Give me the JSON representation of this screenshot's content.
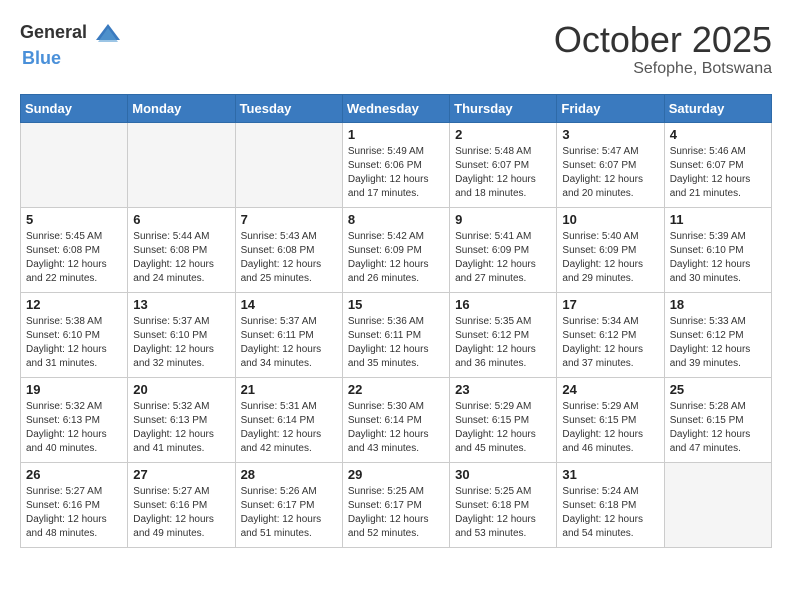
{
  "logo": {
    "general": "General",
    "blue": "Blue"
  },
  "title": {
    "month": "October 2025",
    "location": "Sefophe, Botswana"
  },
  "days_of_week": [
    "Sunday",
    "Monday",
    "Tuesday",
    "Wednesday",
    "Thursday",
    "Friday",
    "Saturday"
  ],
  "weeks": [
    [
      {
        "day": "",
        "info": ""
      },
      {
        "day": "",
        "info": ""
      },
      {
        "day": "",
        "info": ""
      },
      {
        "day": "1",
        "info": "Sunrise: 5:49 AM\nSunset: 6:06 PM\nDaylight: 12 hours\nand 17 minutes."
      },
      {
        "day": "2",
        "info": "Sunrise: 5:48 AM\nSunset: 6:07 PM\nDaylight: 12 hours\nand 18 minutes."
      },
      {
        "day": "3",
        "info": "Sunrise: 5:47 AM\nSunset: 6:07 PM\nDaylight: 12 hours\nand 20 minutes."
      },
      {
        "day": "4",
        "info": "Sunrise: 5:46 AM\nSunset: 6:07 PM\nDaylight: 12 hours\nand 21 minutes."
      }
    ],
    [
      {
        "day": "5",
        "info": "Sunrise: 5:45 AM\nSunset: 6:08 PM\nDaylight: 12 hours\nand 22 minutes."
      },
      {
        "day": "6",
        "info": "Sunrise: 5:44 AM\nSunset: 6:08 PM\nDaylight: 12 hours\nand 24 minutes."
      },
      {
        "day": "7",
        "info": "Sunrise: 5:43 AM\nSunset: 6:08 PM\nDaylight: 12 hours\nand 25 minutes."
      },
      {
        "day": "8",
        "info": "Sunrise: 5:42 AM\nSunset: 6:09 PM\nDaylight: 12 hours\nand 26 minutes."
      },
      {
        "day": "9",
        "info": "Sunrise: 5:41 AM\nSunset: 6:09 PM\nDaylight: 12 hours\nand 27 minutes."
      },
      {
        "day": "10",
        "info": "Sunrise: 5:40 AM\nSunset: 6:09 PM\nDaylight: 12 hours\nand 29 minutes."
      },
      {
        "day": "11",
        "info": "Sunrise: 5:39 AM\nSunset: 6:10 PM\nDaylight: 12 hours\nand 30 minutes."
      }
    ],
    [
      {
        "day": "12",
        "info": "Sunrise: 5:38 AM\nSunset: 6:10 PM\nDaylight: 12 hours\nand 31 minutes."
      },
      {
        "day": "13",
        "info": "Sunrise: 5:37 AM\nSunset: 6:10 PM\nDaylight: 12 hours\nand 32 minutes."
      },
      {
        "day": "14",
        "info": "Sunrise: 5:37 AM\nSunset: 6:11 PM\nDaylight: 12 hours\nand 34 minutes."
      },
      {
        "day": "15",
        "info": "Sunrise: 5:36 AM\nSunset: 6:11 PM\nDaylight: 12 hours\nand 35 minutes."
      },
      {
        "day": "16",
        "info": "Sunrise: 5:35 AM\nSunset: 6:12 PM\nDaylight: 12 hours\nand 36 minutes."
      },
      {
        "day": "17",
        "info": "Sunrise: 5:34 AM\nSunset: 6:12 PM\nDaylight: 12 hours\nand 37 minutes."
      },
      {
        "day": "18",
        "info": "Sunrise: 5:33 AM\nSunset: 6:12 PM\nDaylight: 12 hours\nand 39 minutes."
      }
    ],
    [
      {
        "day": "19",
        "info": "Sunrise: 5:32 AM\nSunset: 6:13 PM\nDaylight: 12 hours\nand 40 minutes."
      },
      {
        "day": "20",
        "info": "Sunrise: 5:32 AM\nSunset: 6:13 PM\nDaylight: 12 hours\nand 41 minutes."
      },
      {
        "day": "21",
        "info": "Sunrise: 5:31 AM\nSunset: 6:14 PM\nDaylight: 12 hours\nand 42 minutes."
      },
      {
        "day": "22",
        "info": "Sunrise: 5:30 AM\nSunset: 6:14 PM\nDaylight: 12 hours\nand 43 minutes."
      },
      {
        "day": "23",
        "info": "Sunrise: 5:29 AM\nSunset: 6:15 PM\nDaylight: 12 hours\nand 45 minutes."
      },
      {
        "day": "24",
        "info": "Sunrise: 5:29 AM\nSunset: 6:15 PM\nDaylight: 12 hours\nand 46 minutes."
      },
      {
        "day": "25",
        "info": "Sunrise: 5:28 AM\nSunset: 6:15 PM\nDaylight: 12 hours\nand 47 minutes."
      }
    ],
    [
      {
        "day": "26",
        "info": "Sunrise: 5:27 AM\nSunset: 6:16 PM\nDaylight: 12 hours\nand 48 minutes."
      },
      {
        "day": "27",
        "info": "Sunrise: 5:27 AM\nSunset: 6:16 PM\nDaylight: 12 hours\nand 49 minutes."
      },
      {
        "day": "28",
        "info": "Sunrise: 5:26 AM\nSunset: 6:17 PM\nDaylight: 12 hours\nand 51 minutes."
      },
      {
        "day": "29",
        "info": "Sunrise: 5:25 AM\nSunset: 6:17 PM\nDaylight: 12 hours\nand 52 minutes."
      },
      {
        "day": "30",
        "info": "Sunrise: 5:25 AM\nSunset: 6:18 PM\nDaylight: 12 hours\nand 53 minutes."
      },
      {
        "day": "31",
        "info": "Sunrise: 5:24 AM\nSunset: 6:18 PM\nDaylight: 12 hours\nand 54 minutes."
      },
      {
        "day": "",
        "info": ""
      }
    ]
  ]
}
